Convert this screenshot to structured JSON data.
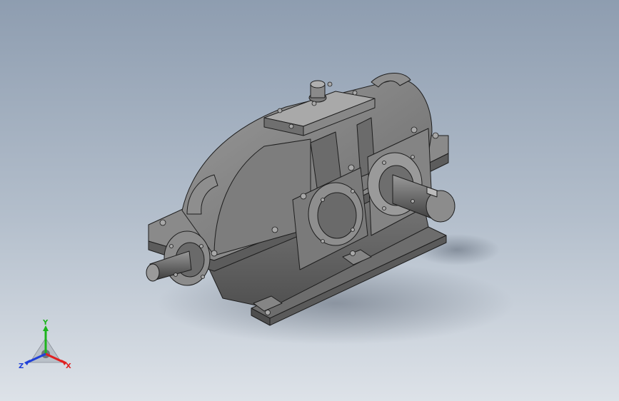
{
  "triad": {
    "x_label": "X",
    "y_label": "Y",
    "z_label": "Z",
    "colors": {
      "x": "#e02020",
      "y": "#1db41d",
      "z": "#2040d8"
    }
  },
  "viewport": {
    "background_top": "#8e9db0",
    "background_bottom": "#dde2e8"
  }
}
